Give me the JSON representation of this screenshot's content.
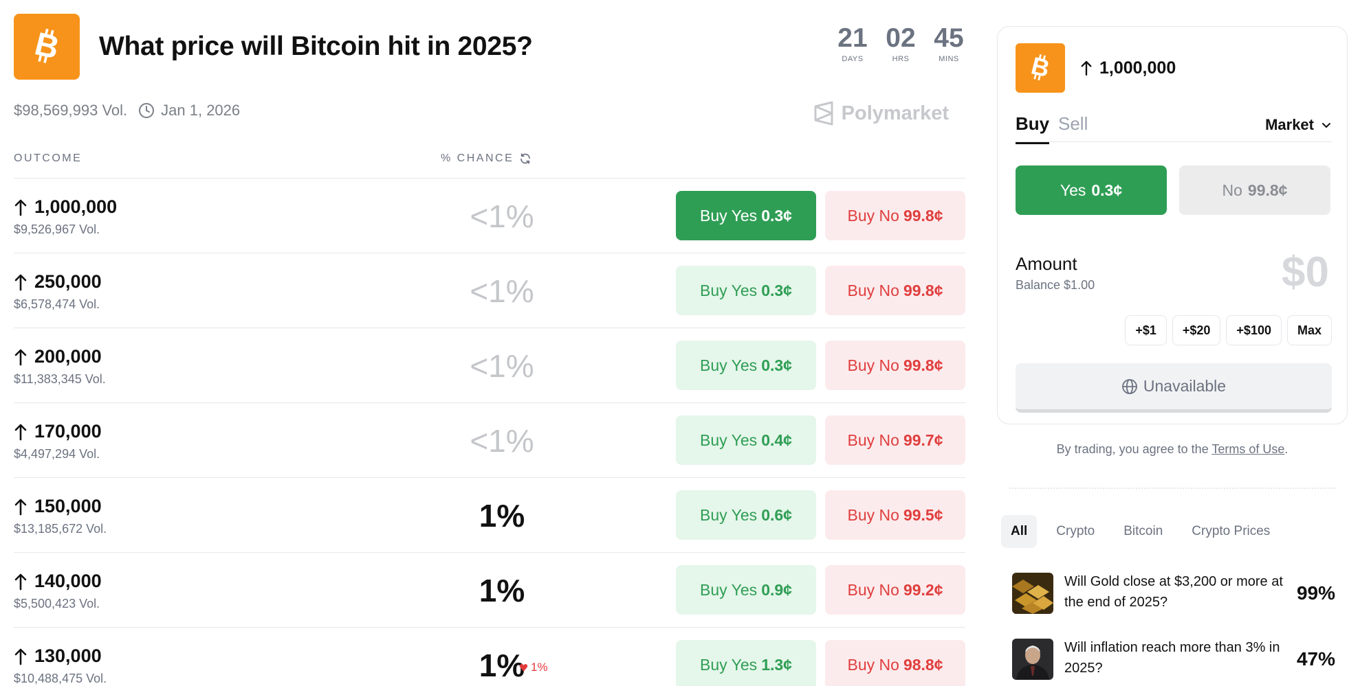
{
  "market": {
    "title": "What price will Bitcoin hit in 2025?",
    "volume": "$98,569,993 Vol.",
    "end_date": "Jan 1, 2026",
    "brand": "Polymarket",
    "brand_color": "#f7931a"
  },
  "countdown": {
    "days": "21",
    "days_label": "DAYS",
    "hrs": "02",
    "hrs_label": "HRS",
    "mins": "45",
    "mins_label": "MINS"
  },
  "table": {
    "col_outcome": "OUTCOME",
    "col_chance": "% CHANCE",
    "rows": [
      {
        "outcome": "1,000,000",
        "volume": "$9,526,967 Vol.",
        "chance": "<1%",
        "yes_label": "Buy Yes",
        "yes_price": "0.3¢",
        "no_label": "Buy No",
        "no_price": "99.8¢"
      },
      {
        "outcome": "250,000",
        "volume": "$6,578,474 Vol.",
        "chance": "<1%",
        "yes_label": "Buy Yes",
        "yes_price": "0.3¢",
        "no_label": "Buy No",
        "no_price": "99.8¢"
      },
      {
        "outcome": "200,000",
        "volume": "$11,383,345 Vol.",
        "chance": "<1%",
        "yes_label": "Buy Yes",
        "yes_price": "0.3¢",
        "no_label": "Buy No",
        "no_price": "99.8¢"
      },
      {
        "outcome": "170,000",
        "volume": "$4,497,294 Vol.",
        "chance": "<1%",
        "yes_label": "Buy Yes",
        "yes_price": "0.4¢",
        "no_label": "Buy No",
        "no_price": "99.7¢"
      },
      {
        "outcome": "150,000",
        "volume": "$13,185,672 Vol.",
        "chance": "1%",
        "yes_label": "Buy Yes",
        "yes_price": "0.6¢",
        "no_label": "Buy No",
        "no_price": "99.5¢"
      },
      {
        "outcome": "140,000",
        "volume": "$5,500,423 Vol.",
        "chance": "1%",
        "yes_label": "Buy Yes",
        "yes_price": "0.9¢",
        "no_label": "Buy No",
        "no_price": "99.2¢"
      },
      {
        "outcome": "130,000",
        "volume": "$10,488,475 Vol.",
        "chance": "1%",
        "delta": "1%",
        "yes_label": "Buy Yes",
        "yes_price": "1.3¢",
        "no_label": "Buy No",
        "no_price": "98.8¢"
      }
    ]
  },
  "trade": {
    "outcome": "1,000,000",
    "tab_buy": "Buy",
    "tab_sell": "Sell",
    "order_type": "Market",
    "yes_label": "Yes",
    "yes_price": "0.3¢",
    "no_label": "No",
    "no_price": "99.8¢",
    "amount_label": "Amount",
    "balance": "Balance $1.00",
    "amount_value": "$0",
    "quick": [
      "+$1",
      "+$20",
      "+$100",
      "Max"
    ],
    "submit_label": "Unavailable",
    "terms_prefix": "By trading, you agree to the ",
    "terms_link": "Terms of Use",
    "terms_suffix": "."
  },
  "related": {
    "filters": [
      "All",
      "Crypto",
      "Bitcoin",
      "Crypto Prices"
    ],
    "items": [
      {
        "title": "Will Gold close at $3,200 or more at the end of 2025?",
        "pct": "99%"
      },
      {
        "title": "Will inflation reach more than 3% in 2025?",
        "pct": "47%"
      }
    ]
  },
  "colors": {
    "yes": "#2f9e55",
    "no": "#e03e3e",
    "bitcoin": "#f7931a"
  }
}
